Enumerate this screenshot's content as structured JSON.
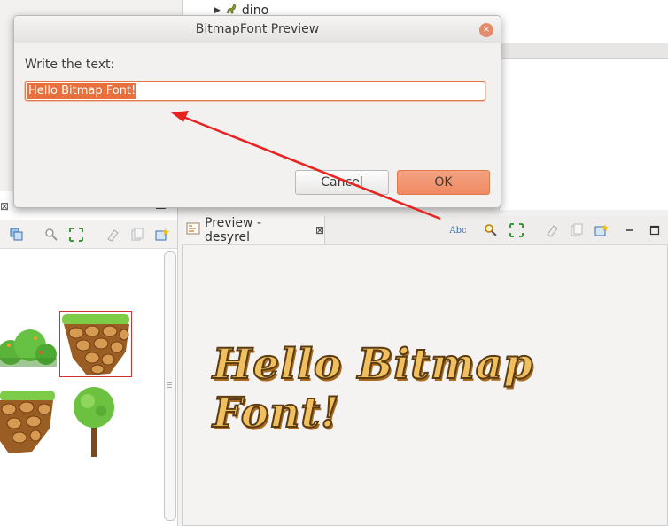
{
  "tree": {
    "item_label": "dino"
  },
  "dialog": {
    "title": "BitmapFont Preview",
    "prompt_label": "Write the text:",
    "input_value": "Hello Bitmap Font!",
    "cancel_label": "Cancel",
    "ok_label": "OK",
    "close_glyph": "×"
  },
  "preview": {
    "tab_title": "Preview - desyrel",
    "close_glyph": "⊠",
    "rendered_text": "Hello Bitmap Font!",
    "toolbar_text_icon": "Abc"
  },
  "left_panel": {
    "close_glyph": "⊠"
  },
  "colors": {
    "accent": "#e9703c",
    "ok_button": "#ef8a62",
    "annotation_arrow": "#e8231f",
    "bitmap_fill": "#f0c060",
    "bitmap_outline": "#5a3b12"
  },
  "icons": [
    "triangle-expand-icon",
    "dino-icon",
    "close-icon",
    "zoom-icon",
    "fit-icon",
    "eraser-icon",
    "copy-icon",
    "new-window-icon",
    "minimize-icon",
    "maximize-icon",
    "abc-text-icon"
  ]
}
